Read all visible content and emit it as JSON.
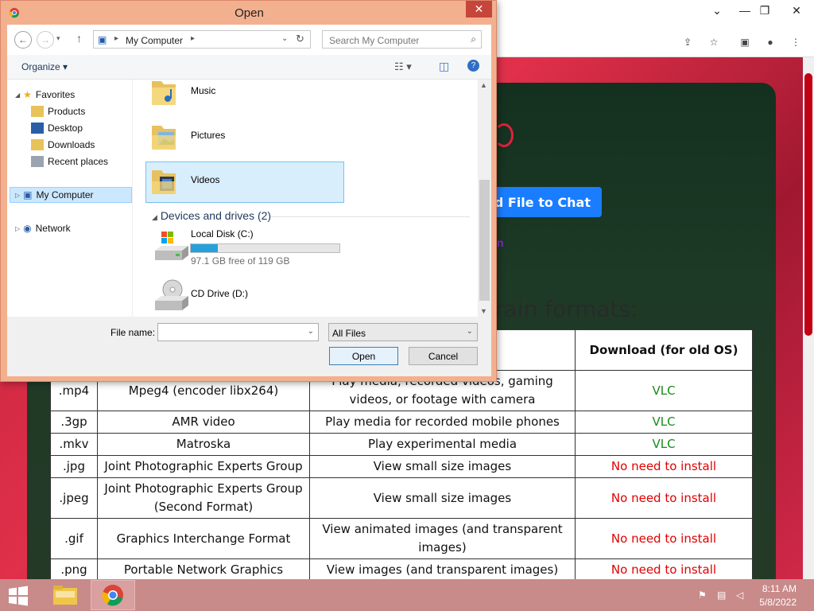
{
  "browser": {
    "toolbar_icons": [
      "share-icon",
      "star-icon",
      "sidepanel-icon",
      "profile-icon",
      "menu-icon"
    ],
    "upload_button_label": "oad File to Chat",
    "partial_link": "n",
    "partial_text": "s",
    "formats_heading": "rain formats:",
    "table": {
      "header_download": "Download (for old OS)",
      "rows": [
        {
          "ext": ".mp4",
          "name": "Mpeg4 (encoder libx264)",
          "use": "Play media, recorded videos, gaming videos, or footage with camera",
          "download": "VLC",
          "status": "green"
        },
        {
          "ext": ".3gp",
          "name": "AMR video",
          "use": "Play media for recorded mobile phones",
          "download": "VLC",
          "status": "green"
        },
        {
          "ext": ".mkv",
          "name": "Matroska",
          "use": "Play experimental media",
          "download": "VLC",
          "status": "green"
        },
        {
          "ext": ".jpg",
          "name": "Joint Photographic Experts Group",
          "use": "View small size images",
          "download": "No need to install",
          "status": "red"
        },
        {
          "ext": ".jpeg",
          "name": "Joint Photographic Experts Group (Second Format)",
          "use": "View small size images",
          "download": "No need to install",
          "status": "red"
        },
        {
          "ext": ".gif",
          "name": "Graphics Interchange Format",
          "use": "View animated images (and transparent images)",
          "download": "No need to install",
          "status": "red"
        },
        {
          "ext": ".png",
          "name": "Portable Network Graphics",
          "use": "View images (and transparent images)",
          "download": "No need to install",
          "status": "red"
        }
      ]
    }
  },
  "dialog": {
    "title": "Open",
    "address": "My Computer",
    "search_placeholder": "Search My Computer",
    "organize_label": "Organize",
    "tree": {
      "favorites": "Favorites",
      "products": "Products",
      "desktop": "Desktop",
      "downloads": "Downloads",
      "recent": "Recent places",
      "my_computer": "My Computer",
      "network": "Network"
    },
    "folders": {
      "music": "Music",
      "pictures": "Pictures",
      "videos": "Videos"
    },
    "drives_header": "Devices and drives (2)",
    "local_disk": {
      "label": "Local Disk (C:)",
      "free": "97.1 GB free of 119 GB",
      "used_fraction": 0.184
    },
    "cd_drive": "CD Drive (D:)",
    "file_name_label": "File name:",
    "file_name_value": "",
    "file_type": "All Files",
    "open_label": "Open",
    "cancel_label": "Cancel"
  },
  "taskbar": {
    "time": "8:11 AM",
    "date": "5/8/2022"
  }
}
